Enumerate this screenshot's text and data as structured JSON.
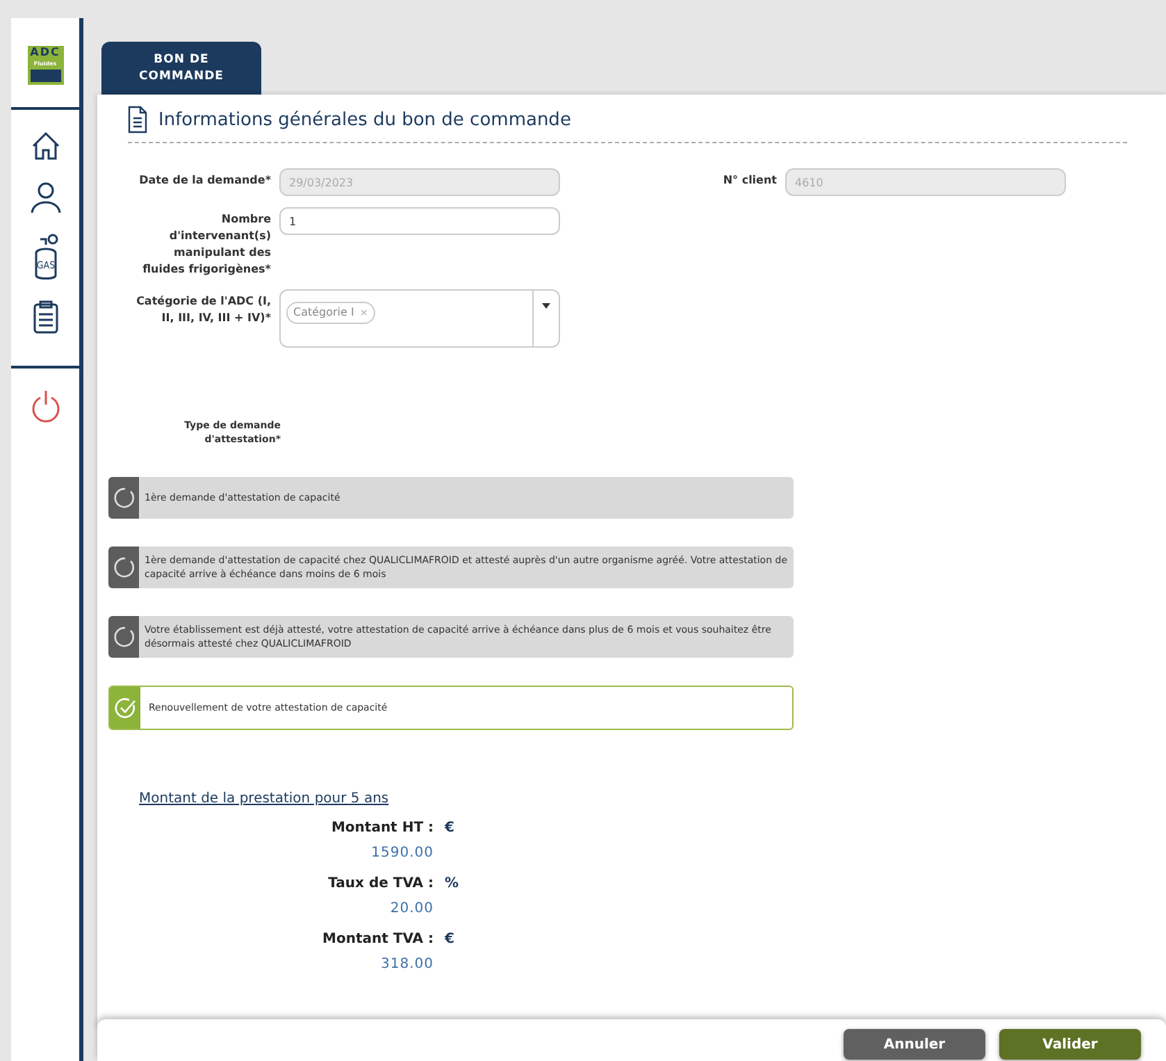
{
  "sidebar": {
    "logo": {
      "title": "ADC",
      "subtitle": "Fluides"
    },
    "gas_label": "GAS"
  },
  "tabs": [
    {
      "label": "BON DE COMMANDE",
      "selected": true
    }
  ],
  "section_title": "Informations générales du bon de commande",
  "fields": [
    {
      "label": "Date de la demande*",
      "value": "29/03/2023",
      "disabled": true
    },
    {
      "label": "N° client",
      "value": "4610",
      "disabled": true
    },
    {
      "label": "Nombre d'intervenant(s) manipulant des fluides frigorigènes*",
      "value": "1",
      "disabled": false
    }
  ],
  "category": {
    "label": "Catégorie de l'ADC (I, II, III, IV, III + IV)*",
    "tags": [
      {
        "label": "Catégorie I",
        "remove": "×"
      }
    ]
  },
  "request_type": {
    "label": "Type de demande d'attestation*",
    "options": [
      {
        "text": "1ère demande d'attestation de capacité",
        "selected": false
      },
      {
        "text": "1ère demande d'attestation de capacité chez QUALICLIMAFROID et attesté auprès d'un autre organisme agréé. Votre attestation de capacité arrive à échéance dans moins de 6 mois",
        "selected": false
      },
      {
        "text": "Votre établissement est déjà attesté, votre attestation de capacité arrive à échéance dans plus de 6 mois et vous souhaitez être désormais attesté chez QUALICLIMAFROID",
        "selected": false
      },
      {
        "text": "Renouvellement de votre attestation de capacité",
        "selected": true
      }
    ]
  },
  "amounts": {
    "heading": "Montant de la prestation pour 5 ans",
    "rows": [
      {
        "label": "Montant HT :",
        "unit": "€",
        "value": "1590.00"
      },
      {
        "label": "Taux de TVA :",
        "unit": "%",
        "value": "20.00"
      },
      {
        "label": "Montant TVA :",
        "unit": "€",
        "value": "318.00"
      }
    ]
  },
  "buttons": [
    {
      "label": "Annuler",
      "kind": "cancel"
    },
    {
      "label": "Valider",
      "kind": "primary"
    }
  ]
}
